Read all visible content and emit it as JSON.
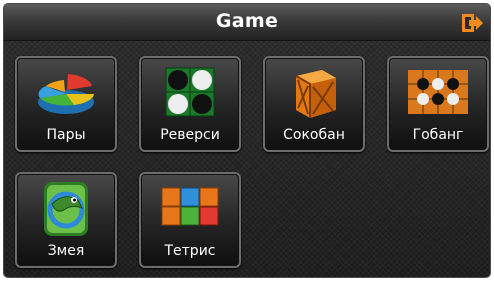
{
  "window": {
    "title": "Game",
    "exit_icon": "exit-icon",
    "accent_color": "#f28a1e"
  },
  "games": [
    {
      "label": "Пары",
      "icon": "pie-chart-icon"
    },
    {
      "label": "Реверси",
      "icon": "reversi-board-icon"
    },
    {
      "label": "Сокобан",
      "icon": "crate-icon"
    },
    {
      "label": "Гобанг",
      "icon": "gobang-board-icon"
    },
    {
      "label": "Змея",
      "icon": "snake-icon"
    },
    {
      "label": "Тетрис",
      "icon": "tetris-blocks-icon"
    }
  ]
}
